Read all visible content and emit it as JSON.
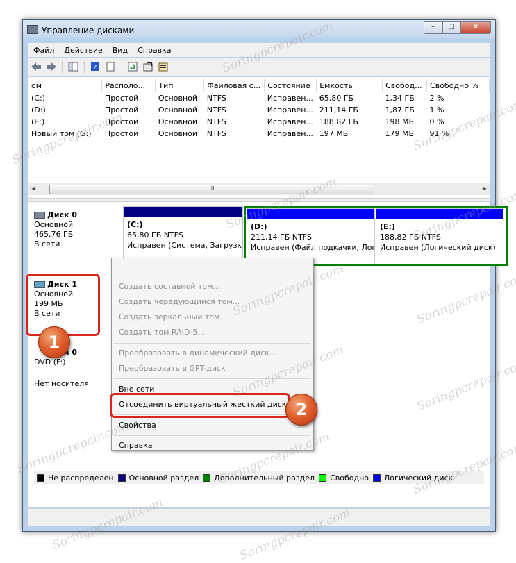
{
  "window": {
    "title": "Управление дисками",
    "btn_min": "–",
    "btn_max": "□",
    "btn_close": "x"
  },
  "menu": [
    "Файл",
    "Действие",
    "Вид",
    "Справка"
  ],
  "toolbar_icons": [
    "back-arrow-icon",
    "forward-arrow-icon",
    "console-tree-icon",
    "help-icon",
    "properties-icon",
    "refresh-icon",
    "settings-icon",
    "export-icon"
  ],
  "volumes": {
    "headers": [
      "ом",
      "Располо...",
      "Тип",
      "Файловая с...",
      "Состояние",
      "Емкость",
      "Свобод...",
      "Свободно %"
    ],
    "rows": [
      [
        "(C:)",
        "Простой",
        "Основной",
        "NTFS",
        "Исправен...",
        "65,80 ГБ",
        "1,34 ГБ",
        "2 %"
      ],
      [
        "(D:)",
        "Простой",
        "Основной",
        "NTFS",
        "Исправен...",
        "211,14 ГБ",
        "1,87 ГБ",
        "1 %"
      ],
      [
        "(E:)",
        "Простой",
        "Основной",
        "NTFS",
        "Исправен...",
        "188,82 ГБ",
        "198 МБ",
        "0 %"
      ],
      [
        "Новый том (G:)",
        "Простой",
        "Основной",
        "NTFS",
        "Исправен...",
        "197 МБ",
        "179 МБ",
        "91 %"
      ]
    ]
  },
  "hscroll": {
    "left": "◄",
    "right": "►",
    "grip": "III"
  },
  "disk0": {
    "name": "Диск 0",
    "type": "Основной",
    "size": "465,76 ГБ",
    "status": "В сети",
    "partitions": [
      {
        "label": "(C:)",
        "size": "65,80 ГБ NTFS",
        "status": "Исправен (Система, Загрузк",
        "color": "#000080"
      },
      {
        "label": "(D:)",
        "size": "211,14 ГБ NTFS",
        "status": "Исправен (Файл подкачки, Лог",
        "color": "#0000ff"
      },
      {
        "label": "(E:)",
        "size": "188,82 ГБ NTFS",
        "status": "Исправен (Логический диск)",
        "color": "#0000ff"
      }
    ],
    "extended_color": "#008000"
  },
  "disk1": {
    "name": "Диск 1",
    "type": "Основной",
    "size": "199 МБ",
    "status": "В сети"
  },
  "cdrom": {
    "name": "ом 0",
    "drive": "DVD (F:)",
    "status": "Нет носителя"
  },
  "context_menu": {
    "create_spanned": "Создать составной том...",
    "create_striped": "Создать чередующийся том...",
    "create_mirrored": "Создать зеркальный том...",
    "create_raid5": "Создать том RAID-5...",
    "convert_dynamic": "Преобразовать в динамический диск...",
    "convert_gpt": "Преобразовать в GPT-диск",
    "offline": "Вне сети",
    "detach_vhd": "Отсоединить виртуальный жесткий диск",
    "properties": "Свойства",
    "help": "Справка"
  },
  "badges": {
    "one": "1",
    "two": "2"
  },
  "legend": [
    {
      "label": "Не распределен",
      "color": "#000000"
    },
    {
      "label": "Основной раздел",
      "color": "#000080"
    },
    {
      "label": "Дополнительный раздел",
      "color": "#008000"
    },
    {
      "label": "Свободно",
      "color": "#00ff00"
    },
    {
      "label": "Логический диск",
      "color": "#0000ff"
    }
  ],
  "watermark": "Soringpcrepair.com"
}
